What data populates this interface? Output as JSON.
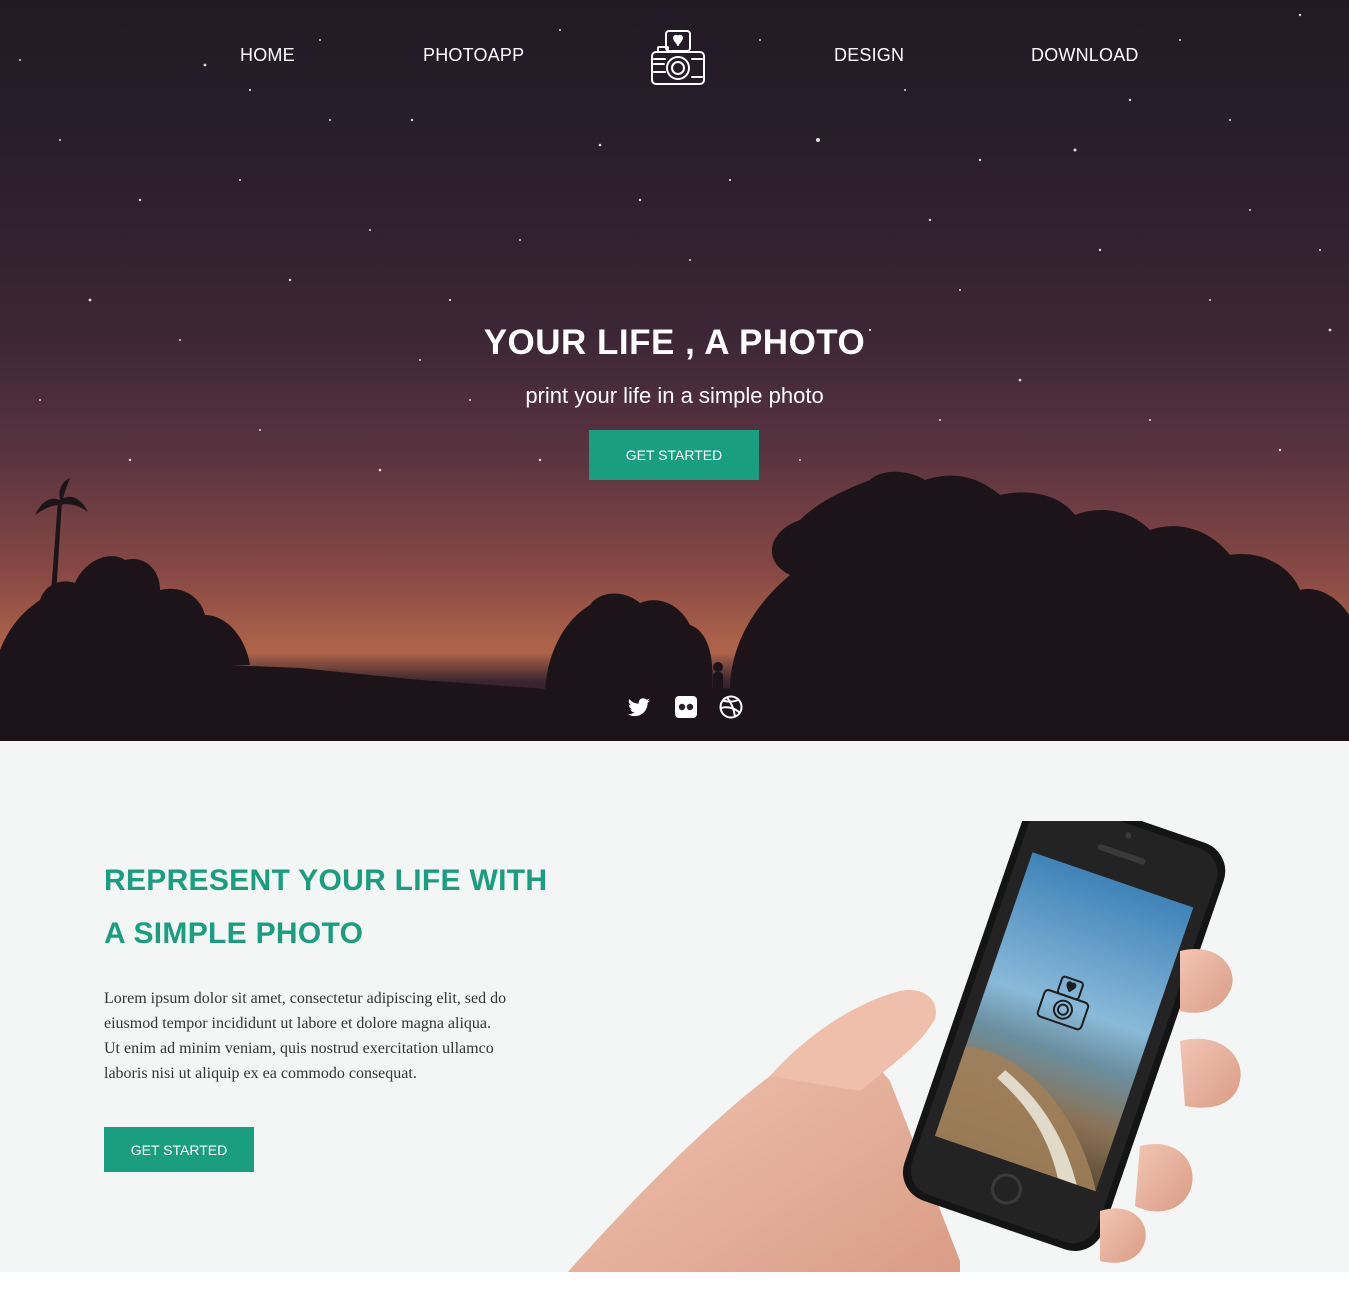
{
  "nav": {
    "items": [
      "HOME",
      "PHOTOAPP",
      "DESIGN",
      "DOWNLOAD"
    ],
    "logo_icon": "camera-heart-icon"
  },
  "hero": {
    "title": "YOUR LIFE , A PHOTO",
    "subtitle": "print your life in a simple photo",
    "cta_label": "GET STARTED",
    "social_icons": [
      "twitter-icon",
      "flickr-icon",
      "dribbble-icon"
    ]
  },
  "feature": {
    "title_line1": "REPRESENT YOUR LIFE WITH",
    "title_line2": "A SIMPLE PHOTO",
    "body_lines": [
      "Lorem ipsum dolor sit amet, consectetur adipiscing elit, sed do",
      "eiusmod tempor incididunt ut labore et dolore magna aliqua.",
      "Ut enim ad minim veniam, quis nostrud exercitation ullamco",
      "laboris nisi ut aliquip ex ea commodo consequat."
    ],
    "cta_label": "GET STARTED",
    "image_icon": "phone-in-hand-image"
  },
  "colors": {
    "accent": "#1a9e80",
    "hero_dark": "#211a25",
    "section_bg": "#f4f5f5",
    "body_text": "#333333"
  }
}
